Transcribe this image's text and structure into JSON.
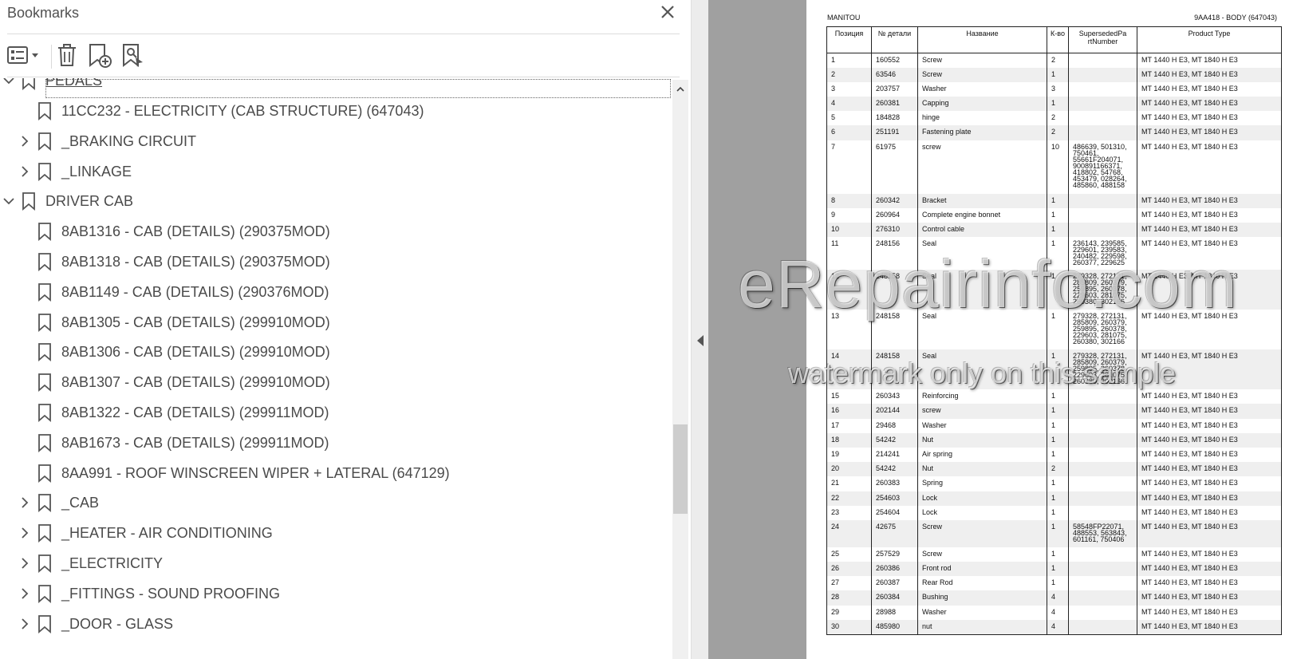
{
  "bookmarks_panel": {
    "title": "Bookmarks",
    "items": [
      {
        "label": "PEDALS",
        "level": 0,
        "chevron": "down",
        "first": true
      },
      {
        "label": "11CC232 - ELECTRICITY (CAB STRUCTURE) (647043)",
        "level": 1,
        "chevron": ""
      },
      {
        "label": "_BRAKING CIRCUIT",
        "level": 1,
        "chevron": "right"
      },
      {
        "label": "_LINKAGE",
        "level": 1,
        "chevron": "right"
      },
      {
        "label": "DRIVER CAB",
        "level": 0,
        "chevron": "down"
      },
      {
        "label": "8AB1316 - CAB (DETAILS) (290375MOD)",
        "level": 1,
        "chevron": ""
      },
      {
        "label": "8AB1318 - CAB (DETAILS) (290375MOD)",
        "level": 1,
        "chevron": ""
      },
      {
        "label": "8AB1149 - CAB (DETAILS) (290376MOD)",
        "level": 1,
        "chevron": ""
      },
      {
        "label": "8AB1305 - CAB (DETAILS) (299910MOD)",
        "level": 1,
        "chevron": ""
      },
      {
        "label": "8AB1306 - CAB (DETAILS) (299910MOD)",
        "level": 1,
        "chevron": ""
      },
      {
        "label": "8AB1307 - CAB (DETAILS) (299910MOD)",
        "level": 1,
        "chevron": ""
      },
      {
        "label": "8AB1322 - CAB (DETAILS) (299911MOD)",
        "level": 1,
        "chevron": ""
      },
      {
        "label": "8AB1673 - CAB (DETAILS) (299911MOD)",
        "level": 1,
        "chevron": ""
      },
      {
        "label": "8AA991 - ROOF WINSCREEN WIPER + LATERAL (647129)",
        "level": 1,
        "chevron": ""
      },
      {
        "label": "_CAB",
        "level": 1,
        "chevron": "right"
      },
      {
        "label": "_HEATER - AIR CONDITIONING",
        "level": 1,
        "chevron": "right"
      },
      {
        "label": "_ELECTRICITY",
        "level": 1,
        "chevron": "right"
      },
      {
        "label": "_FITTINGS - SOUND PROOFING",
        "level": 1,
        "chevron": "right"
      },
      {
        "label": "_DOOR - GLASS",
        "level": 1,
        "chevron": "right"
      }
    ],
    "toolbar_icons": [
      "options-menu-icon",
      "delete-icon",
      "new-bookmark-icon",
      "find-bookmark-icon"
    ],
    "close_icon": "close-icon"
  },
  "document": {
    "header_left": "MANITOU",
    "header_right": "9AA418 - BODY (647043)",
    "columns": [
      "Позиция",
      "№ детали",
      "Название",
      "К-во",
      "SupersededPa rtNumber",
      "Product Type"
    ],
    "rows": [
      [
        "1",
        "160552",
        "Screw",
        "2",
        "",
        "MT 1440 H E3, MT 1840 H E3"
      ],
      [
        "2",
        "63546",
        "Screw",
        "1",
        "",
        "MT 1440 H E3, MT 1840 H E3"
      ],
      [
        "3",
        "203757",
        "Washer",
        "3",
        "",
        "MT 1440 H E3, MT 1840 H E3"
      ],
      [
        "4",
        "260381",
        "Capping",
        "1",
        "",
        "MT 1440 H E3, MT 1840 H E3"
      ],
      [
        "5",
        "184828",
        "hinge",
        "2",
        "",
        "MT 1440 H E3, MT 1840 H E3"
      ],
      [
        "6",
        "251191",
        "Fastening plate",
        "2",
        "",
        "MT 1440 H E3, MT 1840 H E3"
      ],
      [
        "7",
        "61975",
        "screw",
        "10",
        "486639, 501310, 750461, 55661F204071, 900891166371, 418802, 54768, 453479, 028264, 485860, 488158",
        "MT 1440 H E3, MT 1840 H E3"
      ],
      [
        "8",
        "260342",
        "Bracket",
        "1",
        "",
        "MT 1440 H E3, MT 1840 H E3"
      ],
      [
        "9",
        "260964",
        "Complete engine bonnet",
        "1",
        "",
        "MT 1440 H E3, MT 1840 H E3"
      ],
      [
        "10",
        "276310",
        "Control cable",
        "1",
        "",
        "MT 1440 H E3, MT 1840 H E3"
      ],
      [
        "11",
        "248156",
        "Seal",
        "1",
        "236143, 239585, 229601, 239583, 240482, 229598, 260377, 229625",
        "MT 1440 H E3, MT 1840 H E3"
      ],
      [
        "12",
        "248158",
        "Seal",
        "1",
        "279328, 272131, 285809, 260379, 259895, 260378, 229603, 281075, 260380, 302166",
        "MT 1440 H E3, MT 1840 H E3"
      ],
      [
        "13",
        "248158",
        "Seal",
        "1",
        "279328, 272131, 285809, 260379, 259895, 260378, 229603, 281075, 260380, 302166",
        "MT 1440 H E3, MT 1840 H E3"
      ],
      [
        "14",
        "248158",
        "Seal",
        "1",
        "279328, 272131, 285809, 260379, 259895, 260378, 229603, 281075, 260380, 302166",
        "MT 1440 H E3, MT 1840 H E3"
      ],
      [
        "15",
        "260343",
        "Reinforcing",
        "1",
        "",
        "MT 1440 H E3, MT 1840 H E3"
      ],
      [
        "16",
        "202144",
        "screw",
        "1",
        "",
        "MT 1440 H E3, MT 1840 H E3"
      ],
      [
        "17",
        "29468",
        "Washer",
        "1",
        "",
        "MT 1440 H E3, MT 1840 H E3"
      ],
      [
        "18",
        "54242",
        "Nut",
        "1",
        "",
        "MT 1440 H E3, MT 1840 H E3"
      ],
      [
        "19",
        "214241",
        "Air spring",
        "1",
        "",
        "MT 1440 H E3, MT 1840 H E3"
      ],
      [
        "20",
        "54242",
        "Nut",
        "2",
        "",
        "MT 1440 H E3, MT 1840 H E3"
      ],
      [
        "21",
        "260383",
        "Spring",
        "1",
        "",
        "MT 1440 H E3, MT 1840 H E3"
      ],
      [
        "22",
        "254603",
        "Lock",
        "1",
        "",
        "MT 1440 H E3, MT 1840 H E3"
      ],
      [
        "23",
        "254604",
        "Lock",
        "1",
        "",
        "MT 1440 H E3, MT 1840 H E3"
      ],
      [
        "24",
        "42675",
        "Screw",
        "1",
        "58548FP22071, 488553, 563843, 601161, 750406",
        "MT 1440 H E3, MT 1840 H E3"
      ],
      [
        "25",
        "257529",
        "Screw",
        "1",
        "",
        "MT 1440 H E3, MT 1840 H E3"
      ],
      [
        "26",
        "260386",
        "Front rod",
        "1",
        "",
        "MT 1440 H E3, MT 1840 H E3"
      ],
      [
        "27",
        "260387",
        "Rear Rod",
        "1",
        "",
        "MT 1440 H E3, MT 1840 H E3"
      ],
      [
        "28",
        "260384",
        "Bushing",
        "4",
        "",
        "MT 1440 H E3, MT 1840 H E3"
      ],
      [
        "29",
        "28988",
        "Washer",
        "4",
        "",
        "MT 1440 H E3, MT 1840 H E3"
      ],
      [
        "30",
        "485980",
        "nut",
        "4",
        "",
        "MT 1440 H E3, MT 1840 H E3"
      ]
    ],
    "watermark_main": "eRepairinfo.com",
    "watermark_sub": "watermark only on this sample"
  }
}
